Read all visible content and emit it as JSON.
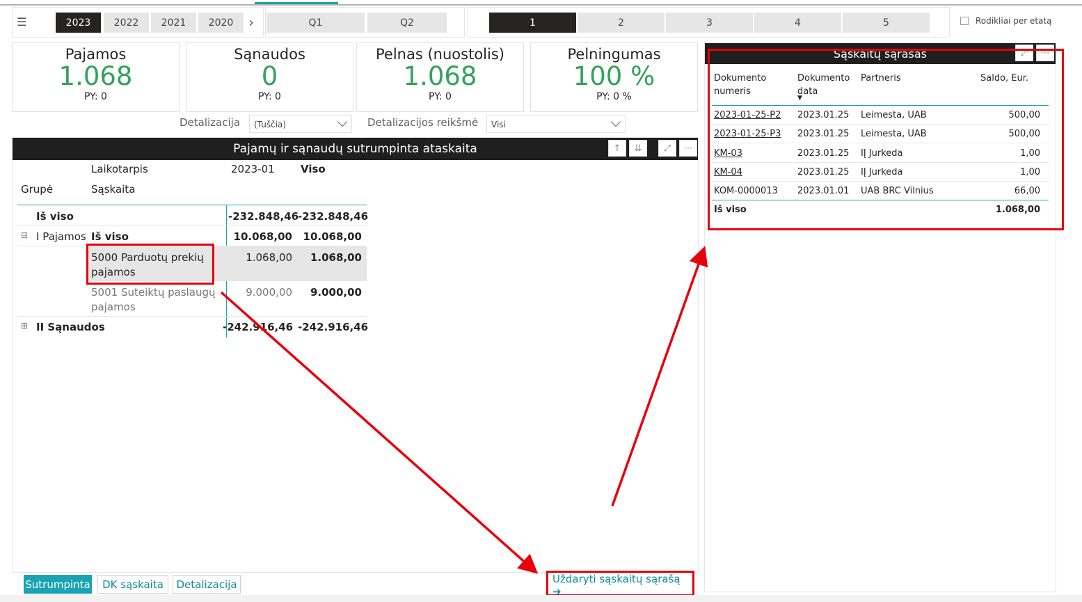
{
  "slicers": {
    "menu_icon": "hamburger-icon",
    "years": [
      "2023",
      "2022",
      "2021",
      "2020"
    ],
    "quarters": [
      "Q1",
      "Q2"
    ],
    "months": [
      "1",
      "2",
      "3",
      "4",
      "5"
    ],
    "checkbox_label": "Rodikliai per etatą"
  },
  "kpis": [
    {
      "title": "Pajamos",
      "value": "1.068",
      "py": "PY: 0"
    },
    {
      "title": "Sąnaudos",
      "value": "0",
      "py": "PY: 0"
    },
    {
      "title": "Pelnas (nuostolis)",
      "value": "1.068",
      "py": "PY: 0"
    },
    {
      "title": "Pelningumas",
      "value": "100 %",
      "py": "PY: 0 %"
    }
  ],
  "filters": {
    "detail_label": "Detalizacija",
    "detail_value": "(Tuščia)",
    "detail_value_label": "Detalizacijos reikšmė",
    "detail_value_value": "Visi"
  },
  "matrix": {
    "title": "Pajamų ir sąnaudų sutrumpinta ataskaita",
    "col_period": "Laikotarpis",
    "col_period_value": "2023-01",
    "col_total": "Viso",
    "row_group": "Grupė",
    "row_account": "Sąskaita",
    "total_label": "Iš viso",
    "total_2023": "-232.848,46",
    "total_all": "-232.848,46",
    "g1_label": "I Pajamos",
    "g1_sub": "Iš viso",
    "g1_2023": "10.068,00",
    "g1_all": "10.068,00",
    "a5000_l1": "5000 Parduotų prekių",
    "a5000_l2": "pajamos",
    "a5000_2023": "1.068,00",
    "a5000_all": "1.068,00",
    "a5001_l1": "5001 Suteiktų paslaugų",
    "a5001_l2": "pajamos",
    "a5001_2023": "9.000,00",
    "a5001_all": "9.000,00",
    "g2_label": "II Sąnaudos",
    "g2_2023": "-242.916,46",
    "g2_all": "-242.916,46"
  },
  "invoices": {
    "title": "Sąskaitų sąrašas",
    "headers": {
      "doc_no_1": "Dokumento",
      "doc_no_2": "numeris",
      "doc_date_1": "Dokumento",
      "doc_date_2": "data",
      "partner": "Partneris",
      "balance": "Saldo, Eur."
    },
    "rows": [
      {
        "no": "2023-01-25-P2",
        "date": "2023.01.25",
        "partner": "Leimesta, UAB",
        "sum": "500,00"
      },
      {
        "no": "2023-01-25-P3",
        "date": "2023.01.25",
        "partner": "Leimesta, UAB",
        "sum": "500,00"
      },
      {
        "no": "KM-03",
        "date": "2023.01.25",
        "partner": "IĮ Jurkeda",
        "sum": "1,00"
      },
      {
        "no": "KM-04",
        "date": "2023.01.25",
        "partner": "IĮ Jurkeda",
        "sum": "1,00"
      },
      {
        "no": "KOM-0000013",
        "date": "2023.01.01",
        "partner": "UAB BRC Vilnius",
        "sum": "66,00"
      }
    ],
    "total_label": "Iš viso",
    "total_sum": "1.068,00"
  },
  "tabs": [
    "Sutrumpinta",
    "DK sąskaita",
    "Detalizacija"
  ],
  "close_link": "Uždaryti sąskaitų sąrašą ➔",
  "colors": {
    "kpi_green": "#33a25a",
    "accent_teal": "#1aa3b3",
    "annotation_red": "#e8000b",
    "header_dark": "#1f1f1f"
  }
}
